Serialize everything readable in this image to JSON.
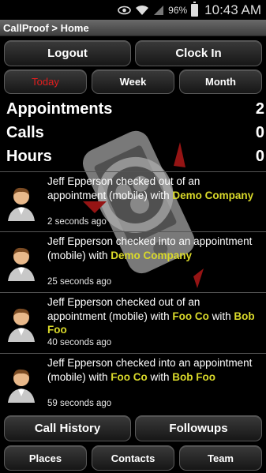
{
  "status_bar": {
    "battery_percent": "96%",
    "battery_level": 0.96,
    "time": "10:43 AM",
    "icons": [
      "eye-icon",
      "wifi-icon",
      "signal-icon",
      "battery-icon"
    ]
  },
  "titlebar": {
    "title": "CallProof > Home"
  },
  "top_buttons": {
    "logout": "Logout",
    "clock_in": "Clock In"
  },
  "period_tabs": {
    "today": "Today",
    "week": "Week",
    "month": "Month",
    "selected": "Today"
  },
  "stats": [
    {
      "label": "Appointments",
      "value": "2"
    },
    {
      "label": "Calls",
      "value": "0"
    },
    {
      "label": "Hours",
      "value": "0"
    }
  ],
  "feed": [
    {
      "text_before": "Jeff Epperson checked out of an appointment (mobile) with ",
      "company": "Demo Company",
      "text_mid": "",
      "contact": "",
      "time": "2 seconds ago"
    },
    {
      "text_before": "Jeff Epperson checked into an appointment (mobile) with ",
      "company": "Demo Company",
      "text_mid": "",
      "contact": "",
      "time": "25 seconds ago"
    },
    {
      "text_before": "Jeff Epperson checked out of an appointment (mobile) with ",
      "company": "Foo Co",
      "text_mid": " with ",
      "contact": "Bob Foo",
      "time": "40 seconds ago"
    },
    {
      "text_before": "Jeff Epperson checked into an appointment (mobile) with ",
      "company": "Foo Co",
      "text_mid": " with ",
      "contact": "Bob Foo",
      "time": "59 seconds ago"
    }
  ],
  "bottom_buttons": {
    "call_history": "Call History",
    "followups": "Followups",
    "places": "Places",
    "contacts": "Contacts",
    "team": "Team"
  },
  "colors": {
    "highlight": "#d9d92a",
    "selected_tab": "#e21e1e",
    "background": "#000000"
  }
}
